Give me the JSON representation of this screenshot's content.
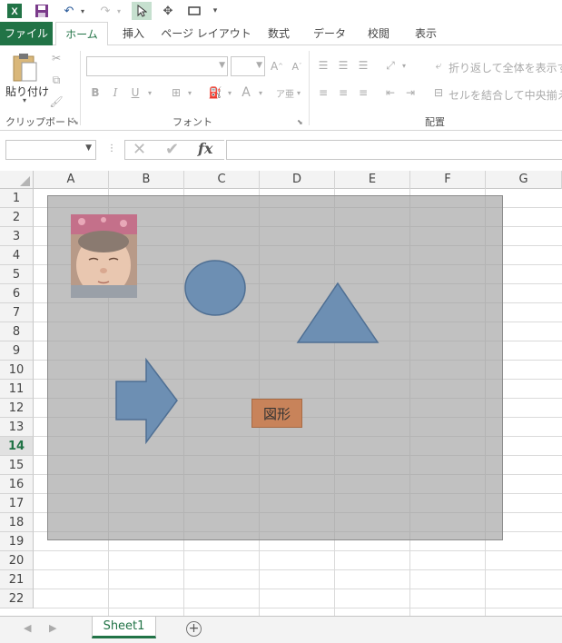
{
  "tabs": [
    "ファイル",
    "ホーム",
    "挿入",
    "ページ レイアウト",
    "数式",
    "データ",
    "校閲",
    "表示"
  ],
  "ribbon": {
    "paste_label": "貼り付け",
    "clipboard_group": "クリップボード",
    "font_group": "フォント",
    "alignment_group": "配置",
    "wrap_text": "折り返して全体を表示する",
    "merge_center": "セルを結合して中央揃え",
    "bold": "B",
    "italic": "I",
    "underline": "U",
    "font_color": "A"
  },
  "formula_bar": {
    "name_box": "",
    "fx": "fx",
    "formula": ""
  },
  "columns": [
    "A",
    "B",
    "C",
    "D",
    "E",
    "F",
    "G"
  ],
  "rows": [
    "1",
    "2",
    "3",
    "4",
    "5",
    "6",
    "7",
    "8",
    "9",
    "10",
    "11",
    "12",
    "13",
    "14",
    "15",
    "16",
    "17",
    "18",
    "19",
    "20",
    "21",
    "22"
  ],
  "selected_row": "14",
  "shape_text": "図形",
  "sheet": {
    "name": "Sheet1",
    "add": "+"
  },
  "colors": {
    "excel_green": "#217346",
    "shape_blue": "#6d8fb3",
    "shape_orange": "#c8835a",
    "group_gray": "#a0a0a0"
  }
}
